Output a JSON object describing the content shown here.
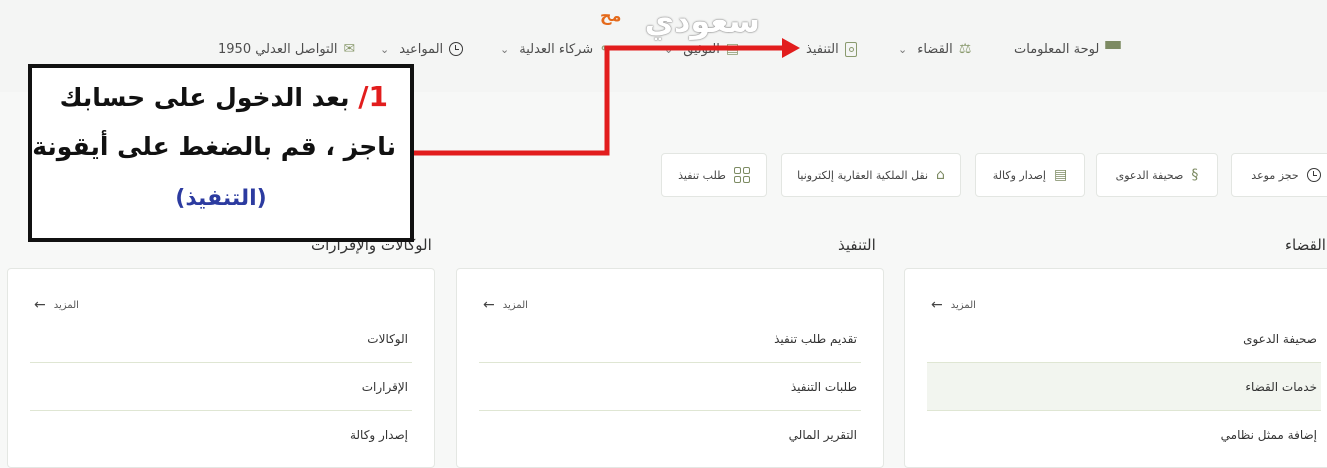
{
  "logo": {
    "text": "سعودي",
    "sub": "مح"
  },
  "nav": {
    "dashboard": "لوحة المعلومات",
    "judiciary": "القضاء",
    "execution": "التنفيذ",
    "notarization": "التوثيق",
    "justice_partners": "شركاء العدلية",
    "appointments": "المواعيد",
    "contact": "التواصل العدلي 1950"
  },
  "quick_services": [
    {
      "label": "حجز موعد",
      "icon": "clock-icon"
    },
    {
      "label": "صحيفة الدعوى",
      "icon": "section-icon"
    },
    {
      "label": "إصدار وكالة",
      "icon": "document-icon"
    },
    {
      "label": "نقل الملكية العقارية إلكترونيا",
      "icon": "home-icon"
    },
    {
      "label": "طلب تنفيذ",
      "icon": "grid-icon"
    }
  ],
  "sections": {
    "judiciary": {
      "title": "القضاء",
      "more": "المزيد",
      "items": [
        "صحيفة الدعوى",
        "خدمات القضاء",
        "إضافة ممثل نظامي"
      ]
    },
    "execution": {
      "title": "التنفيذ",
      "more": "المزيد",
      "items": [
        "تقديم طلب تنفيذ",
        "طلبات التنفيذ",
        "التقرير المالي"
      ]
    },
    "agencies": {
      "title": "الوكالات والإقرارات",
      "more": "المزيد",
      "items": [
        "الوكالات",
        "الإقرارات",
        "إصدار وكالة"
      ]
    }
  },
  "callout": {
    "step": "1",
    "line1": "بعد الدخول على حسابك",
    "line2": "ناجز ، قم بالضغط على أيقونة",
    "line3": "(التنفيذ)"
  },
  "colors": {
    "annotation_red": "#e21d1d",
    "accent_green": "#7d8b63",
    "annotation_blue": "#2c3ba0"
  }
}
